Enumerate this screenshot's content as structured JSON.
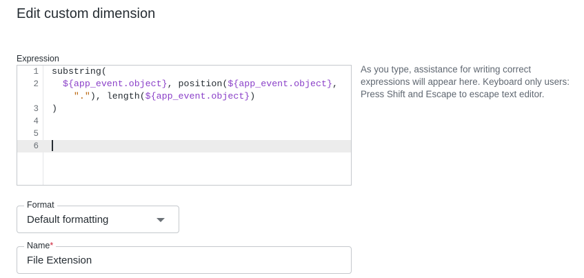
{
  "page": {
    "title": "Edit custom dimension"
  },
  "expression": {
    "label": "Expression",
    "help": "As you type, assistance for writing correct expressions will appear here. Keyboard only users: Press Shift and Escape to escape text editor.",
    "lines": [
      {
        "num": "1",
        "code": [
          {
            "t": "substring(",
            "k": "plain"
          }
        ]
      },
      {
        "num": "2",
        "code": [
          {
            "t": "  ",
            "k": "plain"
          },
          {
            "t": "${app_event.object}",
            "k": "var"
          },
          {
            "t": ", position(",
            "k": "plain"
          },
          {
            "t": "${app_event.object}",
            "k": "var"
          },
          {
            "t": ",",
            "k": "plain"
          }
        ]
      },
      {
        "num": "",
        "code": [
          {
            "t": "    ",
            "k": "plain"
          },
          {
            "t": "\".\"",
            "k": "str"
          },
          {
            "t": "), length(",
            "k": "plain"
          },
          {
            "t": "${app_event.object}",
            "k": "var"
          },
          {
            "t": ")",
            "k": "plain"
          }
        ]
      },
      {
        "num": "3",
        "code": [
          {
            "t": ")",
            "k": "plain"
          }
        ]
      },
      {
        "num": "4",
        "code": []
      },
      {
        "num": "5",
        "code": []
      },
      {
        "num": "6",
        "code": [],
        "active": true,
        "cursor": true
      }
    ]
  },
  "format": {
    "label": "Format",
    "value": "Default formatting"
  },
  "name": {
    "label": "Name",
    "required_mark": "*",
    "value": "File Extension"
  },
  "colors": {
    "variable": "#8a3fc8",
    "string": "#b8640b",
    "required": "#cc1f36"
  }
}
